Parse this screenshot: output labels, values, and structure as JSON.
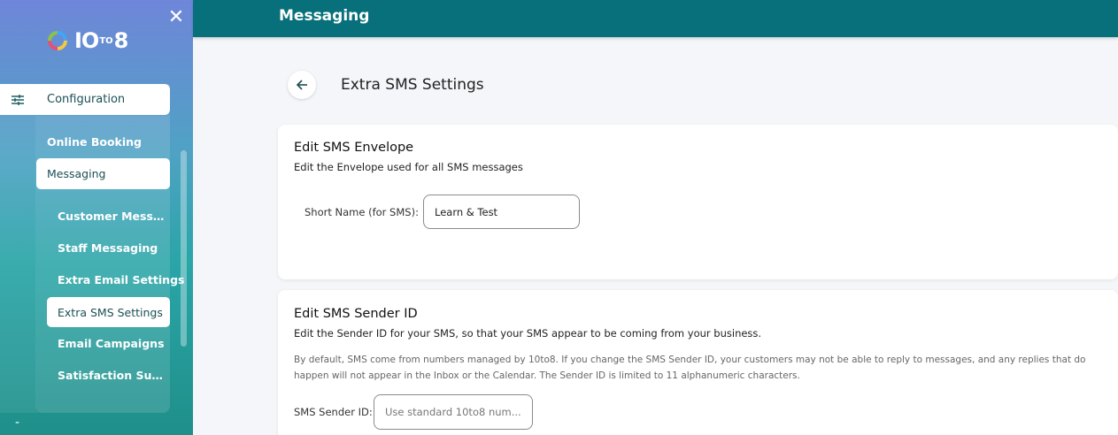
{
  "sidebar": {
    "logo_text_a": "IO",
    "logo_text_b": "TO",
    "logo_text_c": "8",
    "close_symbol": "✕",
    "config_label": "Configuration",
    "items": [
      {
        "label": "Online Booking"
      },
      {
        "label": "Messaging"
      }
    ],
    "subitems": [
      {
        "label": "Customer Messag..."
      },
      {
        "label": "Staff Messaging"
      },
      {
        "label": "Extra Email Settings"
      },
      {
        "label": "Extra SMS Settings"
      },
      {
        "label": "Email Campaigns"
      },
      {
        "label": "Satisfaction Surve..."
      }
    ],
    "dash": "-"
  },
  "topbar": {
    "title": "Messaging"
  },
  "page": {
    "title": "Extra SMS Settings"
  },
  "envelope_card": {
    "heading": "Edit SMS Envelope",
    "subtitle": "Edit the Envelope used for all SMS messages",
    "field_label": "Short Name (for SMS):",
    "field_value": "Learn & Test"
  },
  "sender_card": {
    "heading": "Edit SMS Sender ID",
    "subtitle": "Edit the Sender ID for your SMS, so that your SMS appear to be coming from your business.",
    "note": "By default, SMS come from numbers managed by 10to8. If you change the SMS Sender ID, your customers may not be able to reply to messages, and any replies that do happen will not appear in the Inbox or the Calendar. The Sender ID is limited to 11 alphanumeric characters.",
    "field_label": "SMS Sender ID:",
    "field_placeholder": "Use standard 10to8 num..."
  },
  "colors": {
    "topbar": "#07707a",
    "accent_dark": "#1b4f55"
  }
}
